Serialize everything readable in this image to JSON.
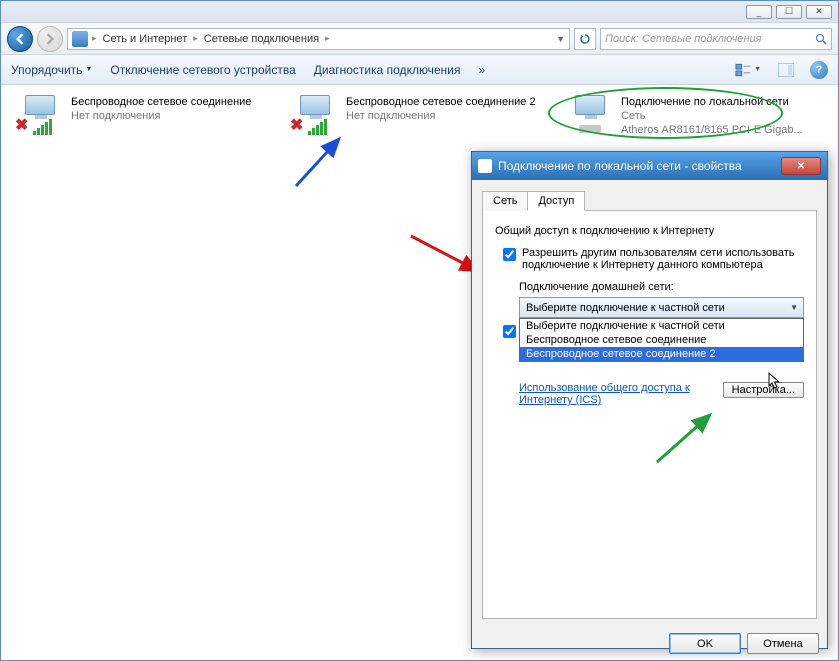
{
  "window": {
    "min_tip": "_",
    "max_tip": "☐",
    "close_tip": "✕"
  },
  "breadcrumb": {
    "a": "Сеть и Интернет",
    "b": "Сетевые подключения"
  },
  "search": {
    "placeholder": "Поиск: Сетевые подключения"
  },
  "toolbar": {
    "organize": "Упорядочить",
    "disable": "Отключение сетевого устройства",
    "diag": "Диагностика подключения",
    "more": "»"
  },
  "connections": [
    {
      "name": "Беспроводное сетевое соединение",
      "status": "Нет подключения",
      "type": "wifi-off"
    },
    {
      "name": "Беспроводное сетевое соединение 2",
      "status": "Нет подключения",
      "type": "wifi-off"
    },
    {
      "name": "Подключение по локальной сети",
      "net": "Сеть",
      "device": "Atheros AR8161/8165 PCI-E Gigab...",
      "type": "lan"
    }
  ],
  "dialog": {
    "title": "Подключение по локальной сети - свойства",
    "tabs": {
      "net": "Сеть",
      "access": "Доступ"
    },
    "group": "Общий доступ к подключению к Интернету",
    "chk1": "Разрешить другим пользователям сети использовать подключение к Интернету данного компьютера",
    "home_label": "Подключение домашней сети:",
    "combo_value": "Выберите подключение к частной сети",
    "options": [
      "Выберите подключение к частной сети",
      "Беспроводное сетевое соединение",
      "Беспроводное сетевое соединение 2"
    ],
    "chk2_prefix": "",
    "link": "Использование общего доступа к Интернету (ICS)",
    "settings": "Настройка...",
    "ok": "OK",
    "cancel": "Отмена"
  }
}
